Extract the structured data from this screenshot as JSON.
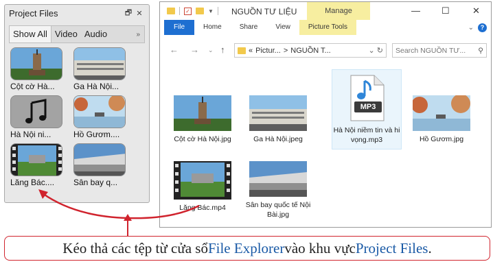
{
  "project_files": {
    "title": "Project Files",
    "tabs": [
      {
        "label": "Show All",
        "active": true
      },
      {
        "label": "Video",
        "active": false
      },
      {
        "label": "Audio",
        "active": false
      }
    ],
    "more": "»",
    "items": [
      {
        "label": "Cột cờ Hà...",
        "kind": "image"
      },
      {
        "label": "Ga Hà Nội...",
        "kind": "image"
      },
      {
        "label": "Hà Nội ni...",
        "kind": "audio"
      },
      {
        "label": "Hồ Gươm....",
        "kind": "image"
      },
      {
        "label": "Lăng Bác....",
        "kind": "video"
      },
      {
        "label": "Sân bay q...",
        "kind": "image"
      }
    ]
  },
  "explorer": {
    "title": "NGUỒN TƯ LIỆU",
    "manage": "Manage",
    "ribbon_tabs": [
      "File",
      "Home",
      "Share",
      "View",
      "Picture Tools"
    ],
    "address": {
      "part1": "Pictur...",
      "sep": ">",
      "part2": "NGUỒN T...",
      "prefix": "«"
    },
    "search_placeholder": "Search NGUỒN TƯ...",
    "files": [
      {
        "name": "Cột cờ Hà Nội.jpg",
        "kind": "image"
      },
      {
        "name": "Ga Hà Nội.jpeg",
        "kind": "image"
      },
      {
        "name": "Hà Nội niềm tin và hi vọng.mp3",
        "kind": "audio",
        "badge": "MP3"
      },
      {
        "name": "Hồ Gươm.jpg",
        "kind": "image"
      },
      {
        "name": "Lăng Bác.mp4",
        "kind": "video"
      },
      {
        "name": "Sân bay quốc tế Nội Bài.jpg",
        "kind": "image"
      }
    ]
  },
  "caption": {
    "before": "Kéo thả các tệp từ cửa sổ ",
    "link1": "File Explorer",
    "middle": " vào khu vực ",
    "link2": "Project Files",
    "after": "."
  },
  "colors": {
    "accent_blue": "#1e6fd1",
    "manage_yellow": "#f7eea0",
    "arrow_red": "#d0232d"
  }
}
